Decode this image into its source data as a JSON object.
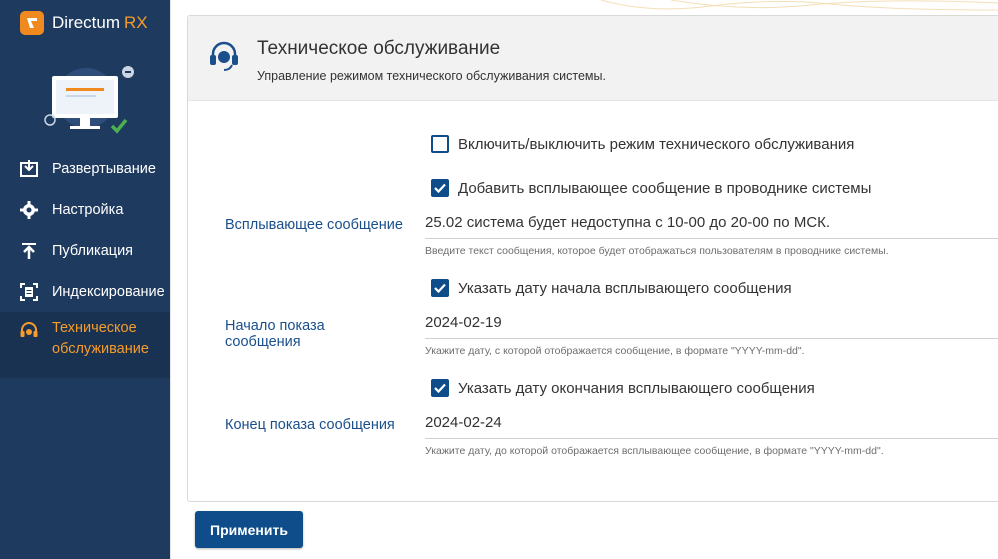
{
  "brand": {
    "name": "Directum",
    "suffix": "RX"
  },
  "sidebar": {
    "items": [
      {
        "label": "Развертывание",
        "icon": "deploy-icon"
      },
      {
        "label": "Настройка",
        "icon": "gear-icon"
      },
      {
        "label": "Публикация",
        "icon": "upload-icon"
      },
      {
        "label": "Индексирование",
        "icon": "index-icon"
      },
      {
        "label_line1": "Техническое",
        "label_line2": "обслуживание",
        "icon": "headset-icon",
        "active": true
      }
    ]
  },
  "panel": {
    "title": "Техническое обслуживание",
    "subtitle": "Управление режимом технического обслуживания системы."
  },
  "form": {
    "maintenance_toggle": {
      "label": "Включить/выключить режим технического обслуживания",
      "checked": false
    },
    "popup_toggle": {
      "label": "Добавить всплывающее сообщение в проводнике системы",
      "checked": true
    },
    "popup_message": {
      "label": "Всплывающее сообщение",
      "value": "25.02 система будет недоступна с 10-00 до 20-00 по МСК.",
      "hint": "Введите текст сообщения, которое будет отображаться пользователям в проводнике системы."
    },
    "start_toggle": {
      "label": "Указать дату начала всплывающего сообщения",
      "checked": true
    },
    "start_date": {
      "label_line1": "Начало показа",
      "label_line2": "сообщения",
      "value": "2024-02-19",
      "hint": "Укажите дату, с которой отображается сообщение, в формате \"YYYY-mm-dd\"."
    },
    "end_toggle": {
      "label": "Указать дату окончания всплывающего сообщения",
      "checked": true
    },
    "end_date": {
      "label": "Конец показа сообщения",
      "value": "2024-02-24",
      "hint": "Укажите дату, до которой отображается всплывающее сообщение, в формате \"YYYY-mm-dd\"."
    }
  },
  "actions": {
    "apply_label": "Применить"
  },
  "colors": {
    "sidebar_bg": "#1f3a5f",
    "accent": "#f59c2a",
    "primary": "#0f4c8a",
    "label_blue": "#1a4f8b"
  }
}
